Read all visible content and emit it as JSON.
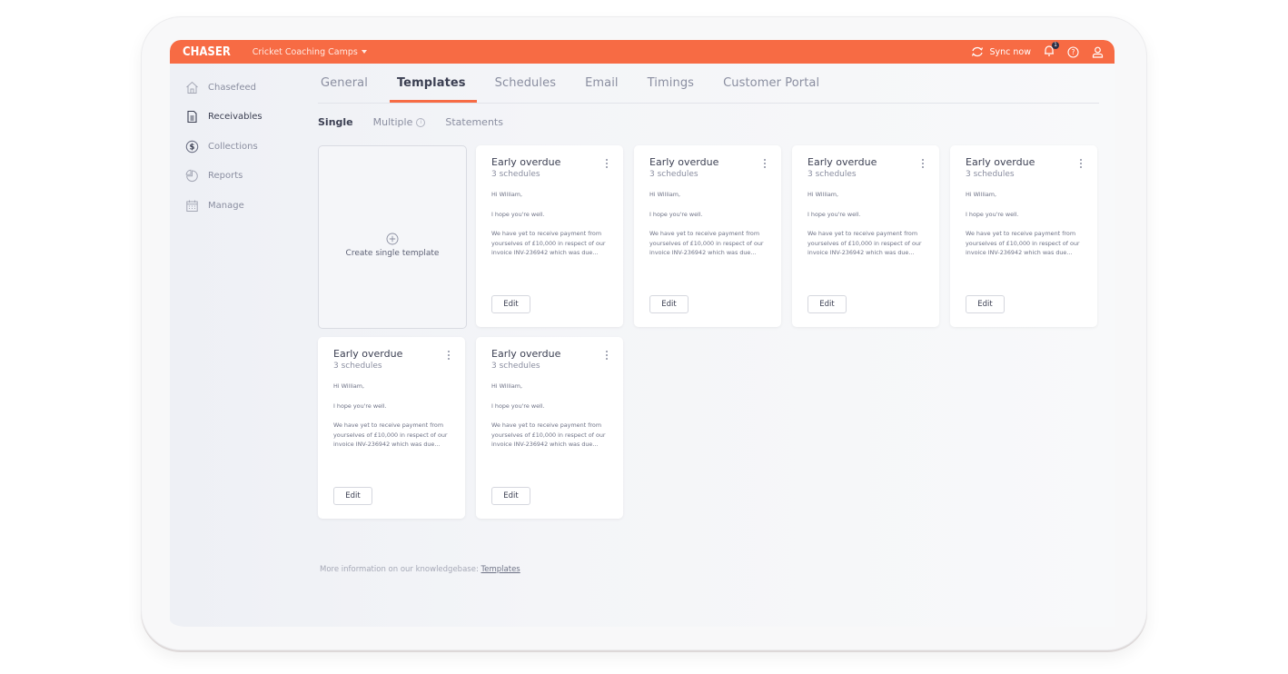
{
  "app": {
    "logo": "CHASER",
    "org_name": "Cricket Coaching Camps",
    "sync_label": "Sync now",
    "notification_count": "1",
    "brand_color": "#f76b44"
  },
  "sidebar": {
    "items": [
      {
        "label": "Chasefeed",
        "icon": "home-icon"
      },
      {
        "label": "Receivables",
        "icon": "document-icon"
      },
      {
        "label": "Collections",
        "icon": "dollar-circle-icon"
      },
      {
        "label": "Reports",
        "icon": "pie-chart-icon"
      },
      {
        "label": "Manage",
        "icon": "calendar-icon"
      }
    ],
    "active": "Receivables"
  },
  "tabs": [
    {
      "label": "General"
    },
    {
      "label": "Templates"
    },
    {
      "label": "Schedules"
    },
    {
      "label": "Email"
    },
    {
      "label": "Timings"
    },
    {
      "label": "Customer Portal"
    }
  ],
  "active_tab": "Templates",
  "subtabs": [
    {
      "label": "Single"
    },
    {
      "label": "Multiple"
    },
    {
      "label": "Statements"
    }
  ],
  "active_subtab": "Single",
  "create_card": {
    "label": "Create single template"
  },
  "templates": [
    {
      "title": "Early overdue",
      "subtitle": "3 schedules",
      "greeting": "Hi William,",
      "line2": "I hope you're well.",
      "body": "We have yet to receive payment from yourselves of £10,000 in respect of  our invoice INV-236942 which was due...",
      "edit_label": "Edit"
    },
    {
      "title": "Early overdue",
      "subtitle": "3 schedules",
      "greeting": "Hi William,",
      "line2": "I hope you're well.",
      "body": "We have yet to receive payment from yourselves of £10,000 in respect of  our invoice INV-236942 which was due...",
      "edit_label": "Edit"
    },
    {
      "title": "Early overdue",
      "subtitle": "3 schedules",
      "greeting": "Hi William,",
      "line2": "I hope you're well.",
      "body": "We have yet to receive payment from yourselves of £10,000 in respect of  our invoice INV-236942 which was due...",
      "edit_label": "Edit"
    },
    {
      "title": "Early overdue",
      "subtitle": "3 schedules",
      "greeting": "Hi William,",
      "line2": "I hope you're well.",
      "body": "We have yet to receive payment from yourselves of £10,000 in respect of  our invoice INV-236942 which was due...",
      "edit_label": "Edit"
    },
    {
      "title": "Early overdue",
      "subtitle": "3 schedules",
      "greeting": "Hi William,",
      "line2": "I hope you're well.",
      "body": "We have yet to receive payment from yourselves of £10,000 in respect of  our invoice INV-236942 which was due...",
      "edit_label": "Edit"
    },
    {
      "title": "Early overdue",
      "subtitle": "3 schedules",
      "greeting": "Hi William,",
      "line2": "I hope you're well.",
      "body": "We have yet to receive payment from yourselves of £10,000 in respect of  our invoice INV-236942 which was due...",
      "edit_label": "Edit"
    }
  ],
  "footer": {
    "text": "More information on our knowledgebase: ",
    "link_label": "Templates"
  }
}
